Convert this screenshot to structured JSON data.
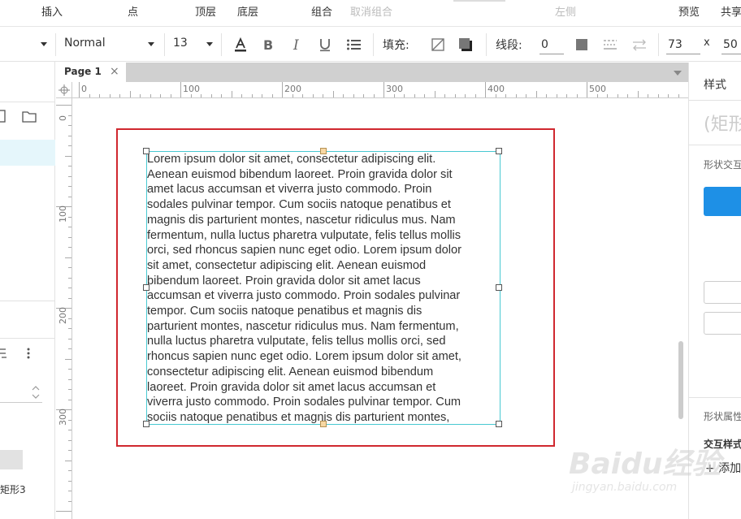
{
  "menu": {
    "insert": "插入",
    "point": "点",
    "bring_to_front": "顶层",
    "send_to_back": "底层",
    "group": "组合",
    "ungroup": "取消组合",
    "align_left": "左侧",
    "preview": "预览",
    "share": "共享"
  },
  "toolbar": {
    "style_select": "Normal",
    "font_size": "13",
    "fill_label": "填充:",
    "line_label": "线段:",
    "line_width": "0",
    "x_value": "73",
    "x_label": "x",
    "y_value": "50"
  },
  "tabs": {
    "page1": "Page 1",
    "close": "×"
  },
  "ruler": {
    "h_labels": [
      "0",
      "100",
      "200",
      "300",
      "400",
      "500"
    ],
    "v_labels": [
      "0",
      "100",
      "200",
      "300"
    ]
  },
  "left_panel": {
    "shape_label": "矩形3"
  },
  "canvas": {
    "text_lines": [
      "Lorem ipsum dolor sit amet, consectetur adipiscing elit.",
      "Aenean euismod bibendum laoreet. Proin gravida dolor sit",
      "amet lacus accumsan et viverra justo commodo. Proin",
      "sodales pulvinar tempor. Cum sociis natoque penatibus et",
      "magnis dis parturient montes, nascetur ridiculus mus. Nam",
      "fermentum, nulla luctus pharetra vulputate, felis tellus mollis",
      "orci, sed rhoncus sapien nunc eget odio. Lorem ipsum dolor",
      "sit amet, consectetur adipiscing elit. Aenean euismod",
      "bibendum laoreet. Proin gravida dolor sit amet lacus",
      "accumsan et viverra justo commodo. Proin sodales pulvinar",
      "tempor. Cum sociis natoque penatibus et magnis dis",
      "parturient montes, nascetur ridiculus mus. Nam fermentum,",
      "nulla luctus pharetra vulputate, felis tellus mollis orci, sed",
      "rhoncus sapien nunc eget odio. Lorem ipsum dolor sit amet,",
      "consectetur adipiscing elit. Aenean euismod bibendum",
      "laoreet. Proin gravida dolor sit amet lacus accumsan et",
      "viverra justo commodo. Proin sodales pulvinar tempor. Cum",
      "sociis natoque penatibus et magnis dis parturient montes,"
    ]
  },
  "right_panel": {
    "style_tab": "样式",
    "shape_name": "(矩形",
    "shape_interaction": "形状交互",
    "shape_properties": "形状属性",
    "interaction_style": "交互样式",
    "add": "+ 添加"
  },
  "watermark": {
    "logo": "Baidu经验",
    "url": "jingyan.baidu.com"
  },
  "colors": {
    "selection_border": "#48c8d2",
    "red_rectangle": "#d0282f",
    "primary_button": "#1e90e6",
    "selected_row": "#e5f6fb"
  }
}
